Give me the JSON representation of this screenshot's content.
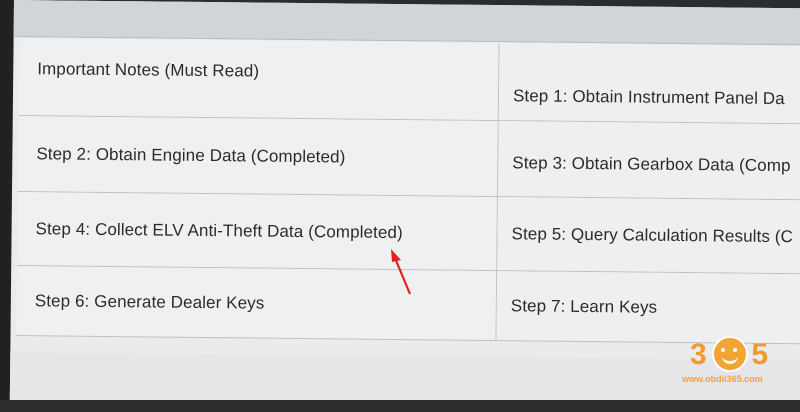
{
  "steps": {
    "notes": "Important Notes (Must Read)",
    "step1": "Step 1: Obtain Instrument Panel Da",
    "step2": "Step 2: Obtain Engine Data (Completed)",
    "step3": "Step 3: Obtain Gearbox Data (Comp",
    "step4": "Step 4: Collect ELV Anti-Theft Data (Completed)",
    "step5": "Step 5: Query Calculation Results (C",
    "step6": "Step 6: Generate Dealer Keys",
    "step7": "Step 7: Learn Keys"
  },
  "watermark": {
    "number": "305",
    "url": "www.obdii365.com"
  },
  "colors": {
    "arrow": "#e0211c",
    "watermark": "#f29a2e"
  }
}
